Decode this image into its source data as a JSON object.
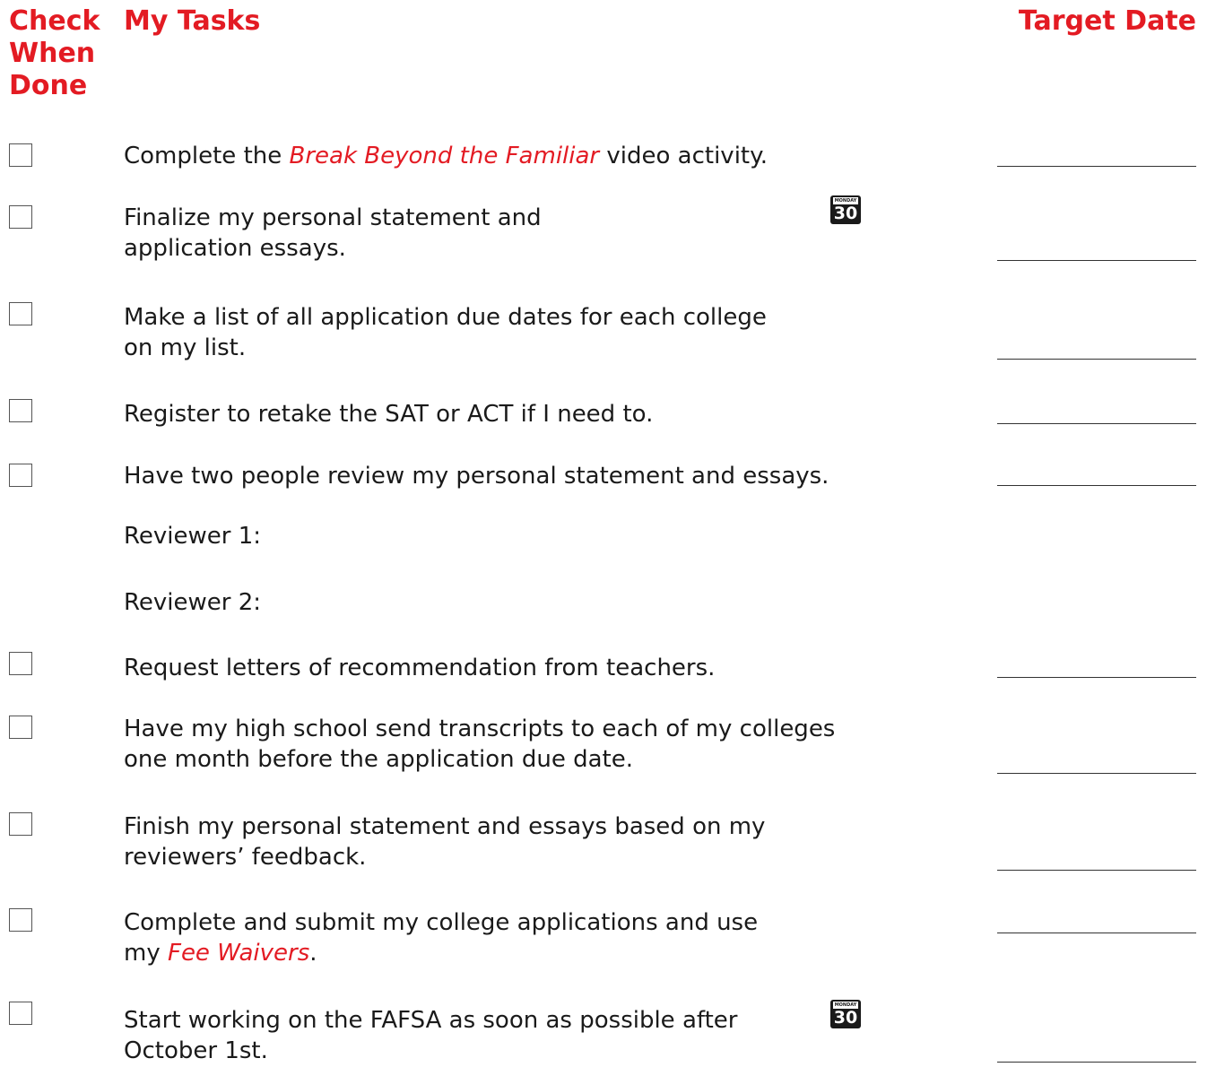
{
  "header": {
    "check_when_done": [
      "Check",
      "When",
      "Done"
    ],
    "my_tasks": "My Tasks",
    "target_date": "Target Date"
  },
  "calendar_icon": {
    "day": "MONDAY",
    "number": "30"
  },
  "tasks": [
    {
      "text_before": "Complete the ",
      "emphasis": "Break Beyond the Familiar",
      "text_after": " video activity."
    },
    {
      "line1": "Finalize my personal statement and",
      "line2": "application essays."
    },
    {
      "line1": "Make a list of all application due dates for each college",
      "line2": "on my list."
    },
    {
      "text": "Register to retake the SAT or ACT if I need to."
    },
    {
      "text": "Have two people review my personal statement and essays."
    },
    {
      "text": "Request letters of recommendation from teachers."
    },
    {
      "line1": "Have my high school send transcripts to each of my colleges",
      "line2": "one month before the application due date."
    },
    {
      "line1": "Finish my personal statement and essays based on my",
      "line2": "reviewers’ feedback."
    },
    {
      "line1": "Complete and submit my college applications and use",
      "line2_before": "my ",
      "line2_emphasis": "Fee Waivers",
      "line2_after": "."
    },
    {
      "line1": "Start working on the FAFSA as soon as possible after",
      "line2": "October 1st."
    }
  ],
  "reviewers": [
    "Reviewer 1:",
    "Reviewer 2:"
  ],
  "colors": {
    "accent_red": "#e31b23",
    "text": "#1a1a1a"
  }
}
